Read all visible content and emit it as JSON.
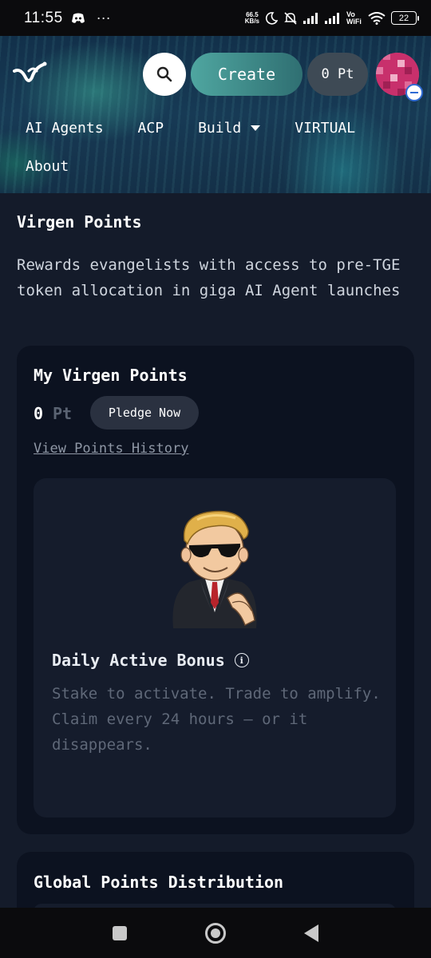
{
  "status_bar": {
    "time": "11:55",
    "dots": "···",
    "net_speed_value": "66.5",
    "net_speed_unit": "KB/s",
    "battery": "22",
    "vowifi": "Vo WiFi"
  },
  "header": {
    "create_label": "Create",
    "points_label": "0 Pt",
    "nav_row1": [
      "AI Agents",
      "ACP",
      "Build",
      "VIRTUAL"
    ],
    "nav_row2": [
      "About"
    ]
  },
  "page": {
    "title": "Virgen Points",
    "description": "Rewards evangelists with access to pre-TGE token allocation in giga AI Agent launches"
  },
  "my_points": {
    "title": "My Virgen Points",
    "value": "0",
    "unit": "Pt",
    "pledge_label": "Pledge Now",
    "history_link": "View Points History"
  },
  "daily_bonus": {
    "title": "Daily Active Bonus",
    "line1": "Stake to activate. Trade to amplify.",
    "line2": "Claim every 24 hours — or it disappears."
  },
  "global": {
    "title": "Global Points Distribution"
  },
  "colors": {
    "background": "#141b2a",
    "card": "#0c1220",
    "inner_card": "#151c2c",
    "create_button": "#4fa6a0",
    "avatar": "#c8306c"
  },
  "icons": [
    "discord-icon",
    "moon-icon",
    "mute-icon",
    "signal-icon",
    "wifi-icon",
    "battery-icon",
    "search-icon",
    "info-icon",
    "square-nav-icon",
    "home-nav-icon",
    "back-nav-icon"
  ]
}
